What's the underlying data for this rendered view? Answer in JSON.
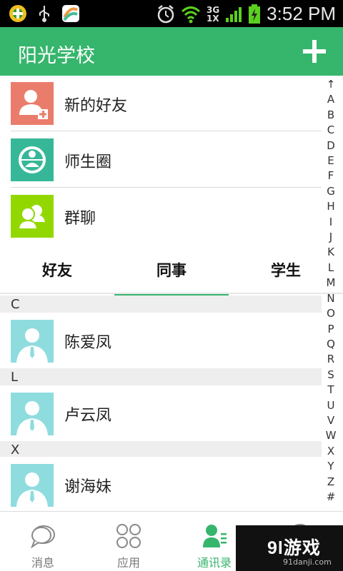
{
  "status_bar": {
    "time": "3:52 PM",
    "network_top": "3G",
    "network_bottom": "1X"
  },
  "header": {
    "title": "阳光学校",
    "add_icon": "plus-icon"
  },
  "top_rows": [
    {
      "label": "新的好友",
      "icon": "add-friend-icon",
      "color": "#ea7c6c"
    },
    {
      "label": "师生圈",
      "icon": "circle-icon",
      "color": "#36b898"
    },
    {
      "label": "群聊",
      "icon": "group-chat-icon",
      "color": "#92d800"
    }
  ],
  "tabs": [
    {
      "label": "好友"
    },
    {
      "label": "同事",
      "active": true
    },
    {
      "label": "学生"
    }
  ],
  "sections": [
    {
      "letter": "C",
      "contacts": [
        {
          "name": "陈爱凤"
        }
      ]
    },
    {
      "letter": "L",
      "contacts": [
        {
          "name": "卢云凤"
        }
      ]
    },
    {
      "letter": "X",
      "contacts": [
        {
          "name": "谢海妹"
        }
      ]
    }
  ],
  "index_letters": [
    "↑",
    "A",
    "B",
    "C",
    "D",
    "E",
    "F",
    "G",
    "H",
    "I",
    "J",
    "K",
    "L",
    "M",
    "N",
    "O",
    "P",
    "Q",
    "R",
    "S",
    "T",
    "U",
    "V",
    "W",
    "X",
    "Y",
    "Z",
    "#"
  ],
  "bottom_nav": [
    {
      "label": "消息",
      "icon": "chat-bubble-icon"
    },
    {
      "label": "应用",
      "icon": "apps-grid-icon"
    },
    {
      "label": "通讯录",
      "icon": "contacts-icon",
      "active": true
    },
    {
      "label": "",
      "icon": "profile-icon"
    }
  ],
  "watermark": {
    "logo": "9l游戏",
    "url": "91danji.com"
  },
  "colors": {
    "accent": "#36b56c",
    "avatar_bg": "#8fdcdf"
  }
}
